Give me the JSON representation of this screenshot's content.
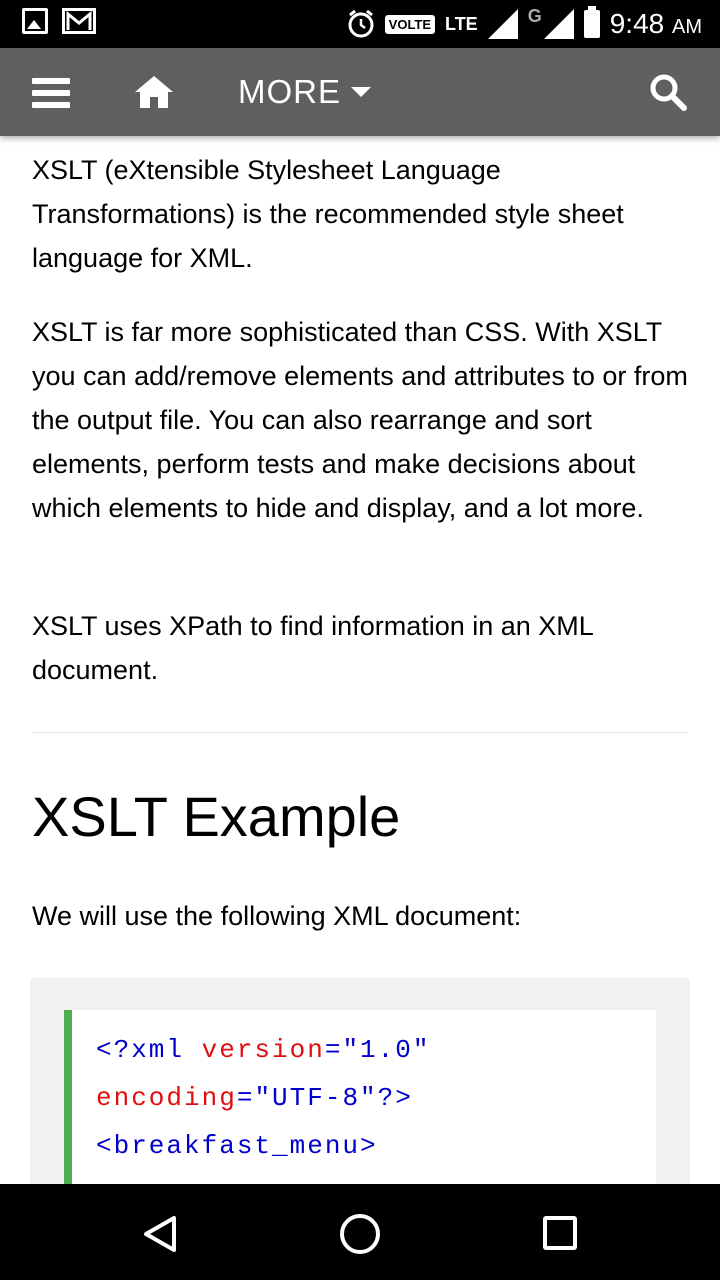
{
  "status_bar": {
    "volte": "VOLTE",
    "lte": "LTE",
    "network_g": "G",
    "time": "9:48",
    "ampm": "AM",
    "icons": [
      "gallery-icon",
      "gmail-icon",
      "alarm-icon",
      "signal-icon",
      "signal-icon",
      "battery-icon"
    ]
  },
  "toolbar": {
    "more_label": "MORE",
    "icons": [
      "menu-icon",
      "home-icon",
      "caret-down-icon",
      "search-icon"
    ],
    "background": "#5f5f5f"
  },
  "content": {
    "paragraph1": "XSLT (eXtensible Stylesheet Language Transformations) is the recommended style sheet language for XML.",
    "paragraph2": "XSLT is far more sophisticated than CSS. With XSLT you can add/remove elements and attributes to or from the output file. You can also rearrange and sort elements, perform tests and make decisions about which elements to hide and display, and a lot more.",
    "paragraph3": "XSLT uses XPath to find information in an XML document.",
    "heading": "XSLT Example",
    "intro": "We will use the following XML document:"
  },
  "code": {
    "line1_tag": "<?xml",
    "line1_attr": " version",
    "line1_eq": "=",
    "line1_val": "\"1.0\"",
    "line2_attr": "encoding",
    "line2_eq": "=",
    "line2_val": "\"UTF-8\"",
    "line2_end": "?>",
    "line3": "<breakfast_menu>",
    "accent": "#4caf50"
  },
  "nav_bar": {
    "icons": [
      "back-icon",
      "home-circle-icon",
      "recent-apps-icon"
    ]
  }
}
